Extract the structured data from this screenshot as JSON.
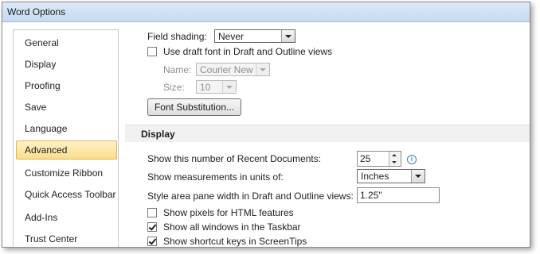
{
  "window": {
    "title": "Word Options"
  },
  "sidebar": {
    "items": [
      {
        "label": "General"
      },
      {
        "label": "Display"
      },
      {
        "label": "Proofing"
      },
      {
        "label": "Save"
      },
      {
        "label": "Language"
      },
      {
        "label": "Advanced"
      },
      {
        "label": "Customize Ribbon"
      },
      {
        "label": "Quick Access Toolbar"
      },
      {
        "label": "Add-Ins"
      },
      {
        "label": "Trust Center"
      }
    ],
    "active": "Advanced"
  },
  "content": {
    "field_shading": {
      "label": "Field shading:",
      "value": "Never"
    },
    "draft_font": {
      "label": "Use draft font in Draft and Outline views",
      "checked": false
    },
    "name": {
      "label": "Name:",
      "value": "Courier New"
    },
    "size": {
      "label": "Size:",
      "value": "10"
    },
    "font_substitution_button": "Font Substitution...",
    "display_section": "Display",
    "recent_documents": {
      "label": "Show this number of Recent Documents:",
      "value": "25"
    },
    "measurements": {
      "label": "Show measurements in units of:",
      "value": "Inches"
    },
    "style_area": {
      "label": "Style area pane width in Draft and Outline views:",
      "value": "1.25\""
    },
    "pixels_html": {
      "label": "Show pixels for HTML features",
      "checked": false
    },
    "all_windows": {
      "label": "Show all windows in the Taskbar",
      "checked": true
    },
    "shortcut_keys": {
      "label": "Show shortcut keys in ScreenTips",
      "checked": true
    }
  },
  "colors": {
    "active_nav": "#fbdd8a",
    "active_border": "#e2b74d",
    "titlebar": "#c6daf0"
  }
}
